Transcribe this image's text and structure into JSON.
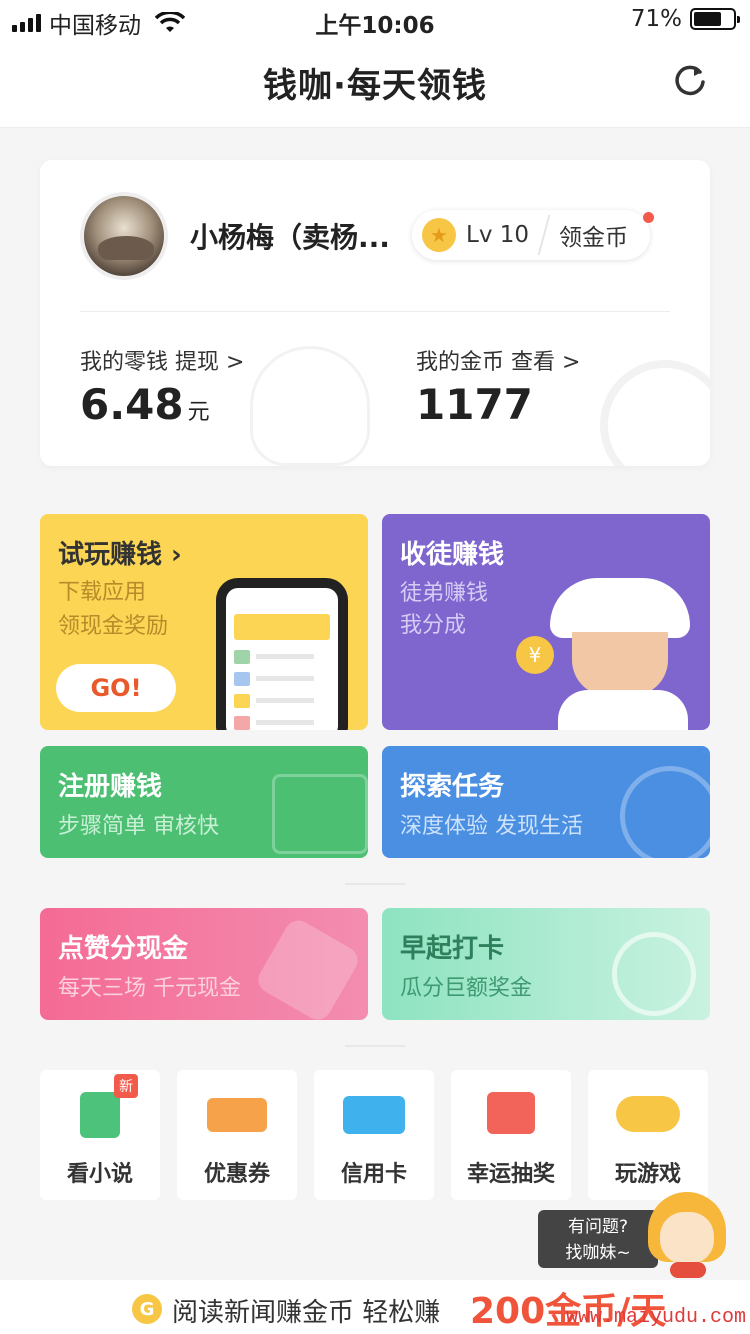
{
  "status": {
    "carrier": "中国移动",
    "time": "上午10:06",
    "battery": "71%",
    "battery_level": 0.71
  },
  "header": {
    "title": "钱咖·每天领钱"
  },
  "account": {
    "username": "小杨梅（卖杨...",
    "level": "Lv 10",
    "gold_button": "领金币",
    "change_label": "我的零钱  提现 >",
    "change_value": "6.48",
    "change_unit": "元",
    "coins_label": "我的金币  查看 >",
    "coins_value": "1177"
  },
  "tasks": {
    "trial": {
      "title": "试玩赚钱 ›",
      "sub1": "下载应用",
      "sub2": "领现金奖励",
      "button": "GO!"
    },
    "apprentice": {
      "title": "收徒赚钱",
      "sub1": "徒弟赚钱",
      "sub2": "我分成"
    },
    "register": {
      "title": "注册赚钱",
      "sub": "步骤简单 审核快"
    },
    "explore": {
      "title": "探索任务",
      "sub": "深度体验 发现生活"
    },
    "like": {
      "title": "点赞分现金",
      "sub": "每天三场 千元现金"
    },
    "early": {
      "title": "早起打卡",
      "sub": "瓜分巨额奖金"
    }
  },
  "tools": [
    {
      "label": "看小说",
      "badge": "新",
      "icon": "book-icon",
      "color": "#4cc27a"
    },
    {
      "label": "优惠券",
      "icon": "coupon-icon",
      "color": "#f5a24a"
    },
    {
      "label": "信用卡",
      "icon": "credit-card-icon",
      "color": "#3fb2ee"
    },
    {
      "label": "幸运抽奖",
      "icon": "gift-icon",
      "color": "#f2645a"
    },
    {
      "label": "玩游戏",
      "icon": "gamepad-icon",
      "color": "#f6c644"
    }
  ],
  "help": {
    "line1": "有问题?",
    "line2": "找咖妹~"
  },
  "banner": {
    "coin_glyph": "G",
    "text": "阅读新闻赚金币 轻松赚",
    "amount": "200金币/天"
  },
  "watermark": "www.maiyudu.com"
}
